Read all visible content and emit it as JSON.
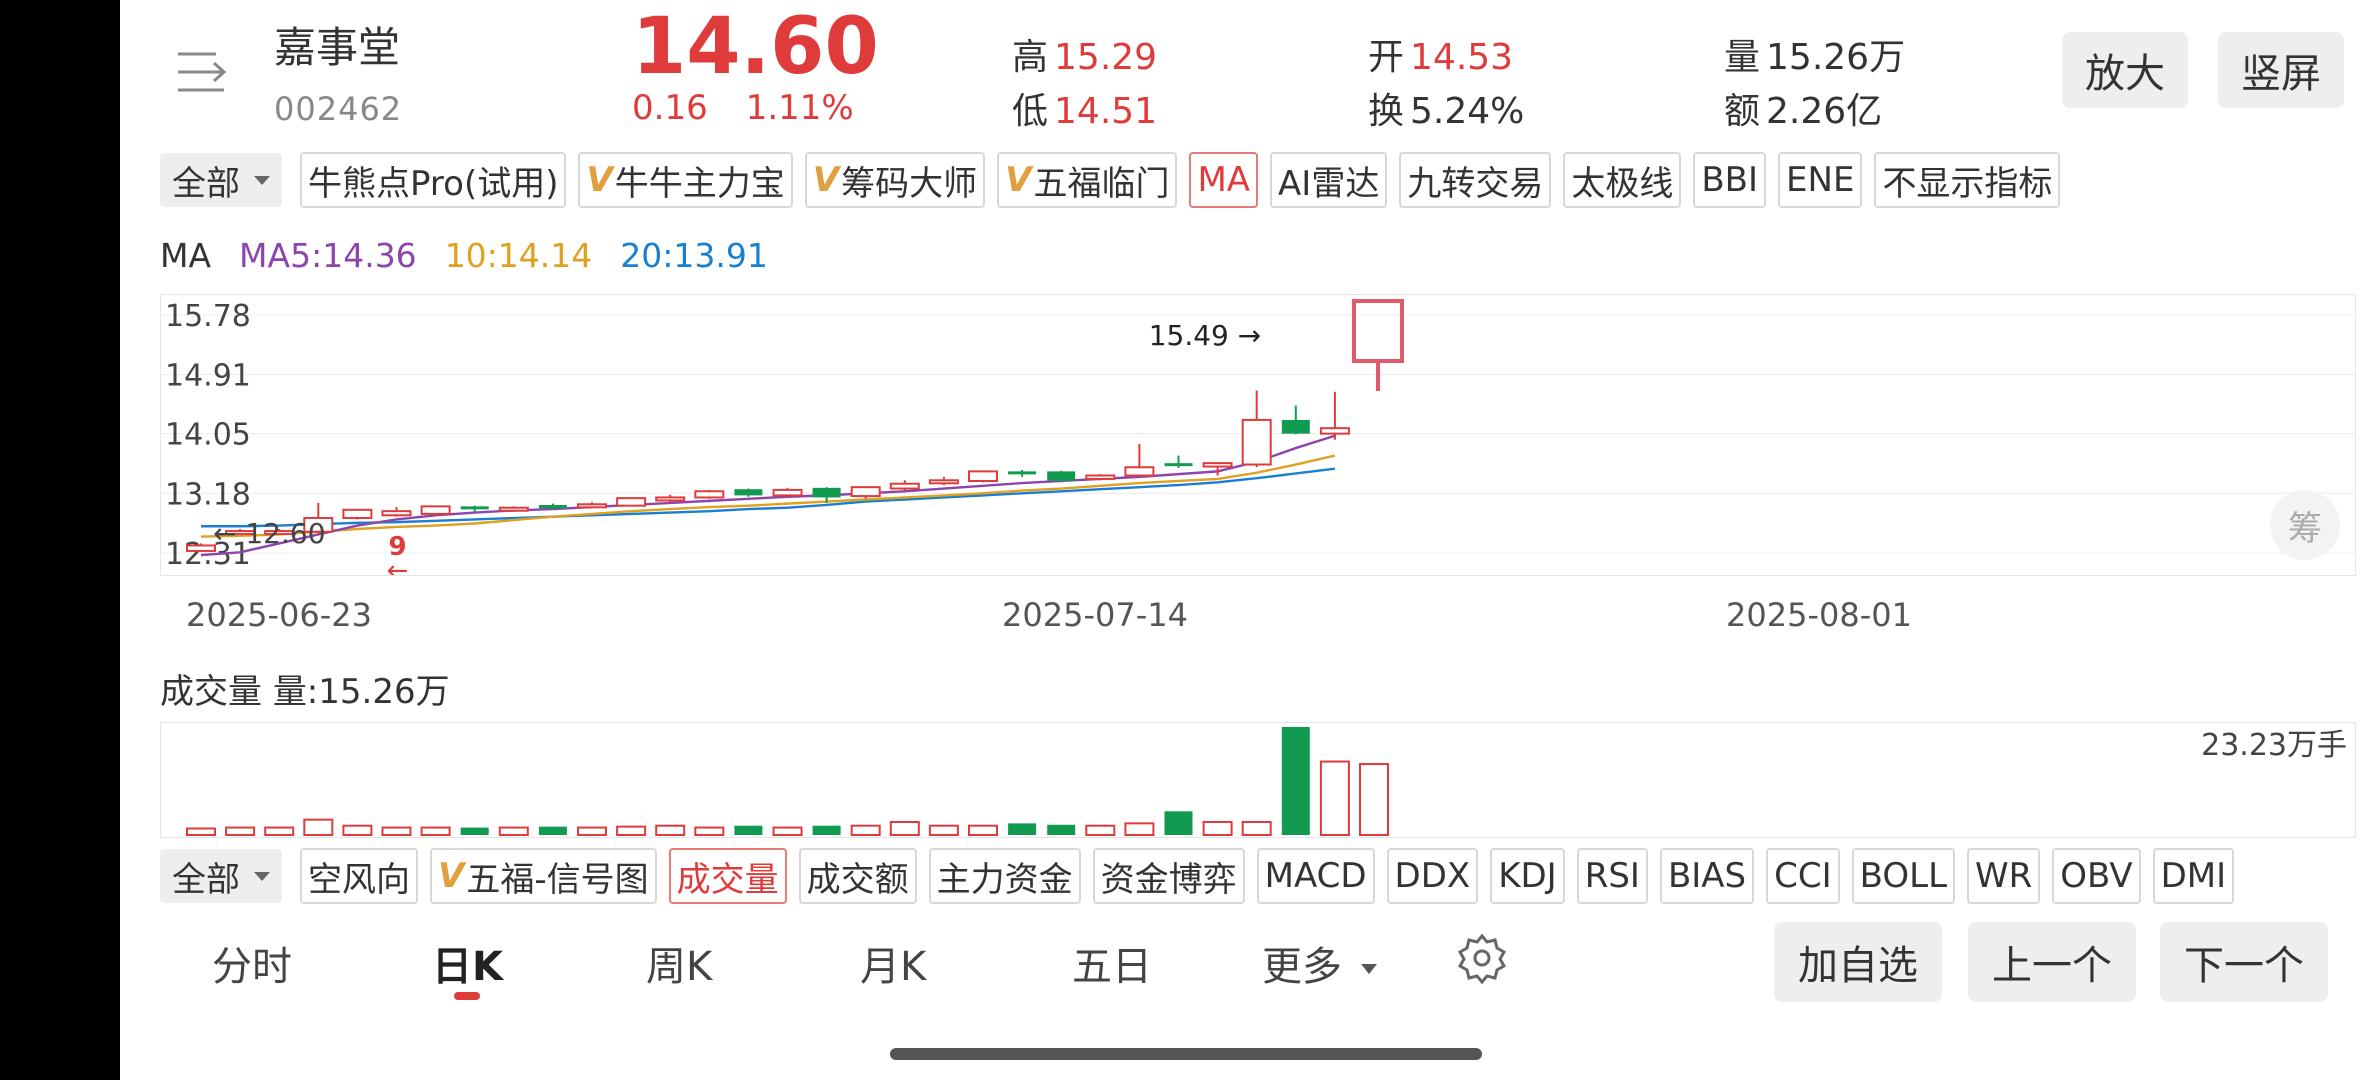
{
  "stock": {
    "name": "嘉事堂",
    "code": "002462",
    "price": "14.60",
    "change": "0.16",
    "change_pct": "1.11%"
  },
  "quote": {
    "high_label": "高",
    "high": "15.29",
    "low_label": "低",
    "low": "14.51",
    "open_label": "开",
    "open": "14.53",
    "turnover_label": "换",
    "turnover": "5.24%",
    "volume_label": "量",
    "volume": "15.26万",
    "amount_label": "额",
    "amount": "2.26亿"
  },
  "header_buttons": {
    "zoom": "放大",
    "portrait": "竖屏"
  },
  "main_indicators": {
    "dropdown": "全部",
    "tags": [
      {
        "label": "牛熊点Pro(试用)",
        "vip": false,
        "active": false
      },
      {
        "label": "牛牛主力宝",
        "vip": true,
        "active": false
      },
      {
        "label": "筹码大师",
        "vip": true,
        "active": false
      },
      {
        "label": "五福临门",
        "vip": true,
        "active": false
      },
      {
        "label": "MA",
        "vip": false,
        "active": true
      },
      {
        "label": "AI雷达",
        "vip": false,
        "active": false
      },
      {
        "label": "九转交易",
        "vip": false,
        "active": false
      },
      {
        "label": "太极线",
        "vip": false,
        "active": false
      },
      {
        "label": "BBI",
        "vip": false,
        "active": false
      },
      {
        "label": "ENE",
        "vip": false,
        "active": false
      },
      {
        "label": "不显示指标",
        "vip": false,
        "active": false
      }
    ]
  },
  "ma_legend": {
    "title": "MA",
    "ma5": "MA5:14.36",
    "ma10": "10:14.14",
    "ma20": "20:13.91",
    "colors": {
      "ma5": "#8e44ad",
      "ma10": "#e0a020",
      "ma20": "#1a7fd0"
    }
  },
  "chart_data": {
    "type": "candlestick",
    "y_ticks": [
      "15.78",
      "14.91",
      "14.05",
      "13.18",
      "12.31"
    ],
    "ylim": [
      12.31,
      15.78
    ],
    "x_labels": [
      "2025-06-23",
      "2025-07-14",
      "2025-08-01"
    ],
    "annotations": {
      "high_marker": "15.49",
      "low_marker": "12.60",
      "nine_count": "9"
    },
    "colors": {
      "up": "#e03b3b",
      "down": "#129b50"
    },
    "candles": [
      {
        "o": 12.34,
        "h": 12.45,
        "l": 12.33,
        "c": 12.42,
        "up": true
      },
      {
        "o": 12.6,
        "h": 12.66,
        "l": 12.58,
        "c": 12.63,
        "up": true
      },
      {
        "o": 12.6,
        "h": 12.66,
        "l": 12.58,
        "c": 12.63,
        "up": true
      },
      {
        "o": 12.62,
        "h": 13.04,
        "l": 12.58,
        "c": 12.82,
        "up": true
      },
      {
        "o": 12.82,
        "h": 12.94,
        "l": 12.8,
        "c": 12.94,
        "up": true
      },
      {
        "o": 12.86,
        "h": 12.98,
        "l": 12.84,
        "c": 12.92,
        "up": true
      },
      {
        "o": 12.88,
        "h": 12.99,
        "l": 12.86,
        "c": 12.99,
        "up": true
      },
      {
        "o": 12.99,
        "h": 13.0,
        "l": 12.91,
        "c": 12.95,
        "up": false
      },
      {
        "o": 12.93,
        "h": 12.99,
        "l": 12.91,
        "c": 12.97,
        "up": true
      },
      {
        "o": 13.01,
        "h": 13.03,
        "l": 12.94,
        "c": 12.96,
        "up": false
      },
      {
        "o": 12.98,
        "h": 13.05,
        "l": 12.96,
        "c": 13.02,
        "up": true
      },
      {
        "o": 13.0,
        "h": 13.11,
        "l": 12.99,
        "c": 13.11,
        "up": true
      },
      {
        "o": 13.09,
        "h": 13.16,
        "l": 13.05,
        "c": 13.12,
        "up": true
      },
      {
        "o": 13.12,
        "h": 13.23,
        "l": 13.1,
        "c": 13.21,
        "up": true
      },
      {
        "o": 13.24,
        "h": 13.25,
        "l": 13.13,
        "c": 13.15,
        "up": false
      },
      {
        "o": 13.15,
        "h": 13.26,
        "l": 13.13,
        "c": 13.23,
        "up": true
      },
      {
        "o": 13.26,
        "h": 13.27,
        "l": 13.04,
        "c": 13.12,
        "up": false
      },
      {
        "o": 13.14,
        "h": 13.28,
        "l": 13.1,
        "c": 13.27,
        "up": true
      },
      {
        "o": 13.25,
        "h": 13.37,
        "l": 13.21,
        "c": 13.32,
        "up": true
      },
      {
        "o": 13.33,
        "h": 13.42,
        "l": 13.3,
        "c": 13.37,
        "up": true
      },
      {
        "o": 13.36,
        "h": 13.5,
        "l": 13.34,
        "c": 13.5,
        "up": true
      },
      {
        "o": 13.5,
        "h": 13.52,
        "l": 13.42,
        "c": 13.47,
        "up": false
      },
      {
        "o": 13.5,
        "h": 13.51,
        "l": 13.34,
        "c": 13.36,
        "up": false
      },
      {
        "o": 13.39,
        "h": 13.46,
        "l": 13.37,
        "c": 13.44,
        "up": true
      },
      {
        "o": 13.44,
        "h": 13.9,
        "l": 13.42,
        "c": 13.56,
        "up": true
      },
      {
        "o": 13.62,
        "h": 13.73,
        "l": 13.55,
        "c": 13.58,
        "up": false
      },
      {
        "o": 13.57,
        "h": 13.63,
        "l": 13.44,
        "c": 13.62,
        "up": true
      },
      {
        "o": 13.6,
        "h": 14.68,
        "l": 13.56,
        "c": 14.25,
        "up": true
      },
      {
        "o": 14.25,
        "h": 14.46,
        "l": 14.04,
        "c": 14.05,
        "up": false
      },
      {
        "o": 14.05,
        "h": 14.66,
        "l": 13.96,
        "c": 14.13,
        "up": true
      }
    ],
    "ma5": [
      12.28,
      12.32,
      12.45,
      12.58,
      12.71,
      12.8,
      12.86,
      12.9,
      12.93,
      12.95,
      12.98,
      13.01,
      13.04,
      13.07,
      13.1,
      13.13,
      13.15,
      13.18,
      13.21,
      13.25,
      13.29,
      13.33,
      13.36,
      13.39,
      13.42,
      13.46,
      13.5,
      13.64,
      13.84,
      14.02
    ],
    "ma10": [
      12.55,
      12.56,
      12.58,
      12.62,
      12.66,
      12.69,
      12.71,
      12.74,
      12.79,
      12.84,
      12.88,
      12.92,
      12.95,
      12.98,
      13.0,
      13.03,
      13.06,
      13.09,
      13.12,
      13.15,
      13.18,
      13.22,
      13.25,
      13.29,
      13.33,
      13.36,
      13.39,
      13.48,
      13.6,
      13.73
    ],
    "ma20": [
      12.7,
      12.7,
      12.71,
      12.73,
      12.75,
      12.76,
      12.78,
      12.8,
      12.82,
      12.84,
      12.86,
      12.88,
      12.9,
      12.92,
      12.95,
      12.97,
      13.01,
      13.06,
      13.09,
      13.12,
      13.15,
      13.18,
      13.21,
      13.24,
      13.27,
      13.3,
      13.34,
      13.4,
      13.47,
      13.54
    ],
    "volume": {
      "title": "成交量",
      "current": "量:15.26万",
      "max_label": "23.23万手",
      "values": [
        1.4,
        1.6,
        1.6,
        3.3,
        2.0,
        1.6,
        1.6,
        1.6,
        1.6,
        1.8,
        1.6,
        1.8,
        2.0,
        1.6,
        2.0,
        1.6,
        2.0,
        2.0,
        2.8,
        2.0,
        2.0,
        2.5,
        2.2,
        2.0,
        2.5,
        5.1,
        2.8,
        2.8,
        23.23,
        15.8,
        15.26
      ]
    }
  },
  "sub_indicators": {
    "dropdown": "全部",
    "tags": [
      {
        "label": "空风向",
        "vip": false,
        "active": false
      },
      {
        "label": "五福-信号图",
        "vip": true,
        "active": false
      },
      {
        "label": "成交量",
        "vip": false,
        "active": true
      },
      {
        "label": "成交额",
        "vip": false,
        "active": false
      },
      {
        "label": "主力资金",
        "vip": false,
        "active": false
      },
      {
        "label": "资金博弈",
        "vip": false,
        "active": false
      },
      {
        "label": "MACD",
        "vip": false,
        "active": false
      },
      {
        "label": "DDX",
        "vip": false,
        "active": false
      },
      {
        "label": "KDJ",
        "vip": false,
        "active": false
      },
      {
        "label": "RSI",
        "vip": false,
        "active": false
      },
      {
        "label": "BIAS",
        "vip": false,
        "active": false
      },
      {
        "label": "CCI",
        "vip": false,
        "active": false
      },
      {
        "label": "BOLL",
        "vip": false,
        "active": false
      },
      {
        "label": "WR",
        "vip": false,
        "active": false
      },
      {
        "label": "OBV",
        "vip": false,
        "active": false
      },
      {
        "label": "DMI",
        "vip": false,
        "active": false
      }
    ]
  },
  "chou_button": "筹",
  "period_tabs": [
    {
      "label": "分时",
      "active": false
    },
    {
      "label": "日K",
      "active": true
    },
    {
      "label": "周K",
      "active": false
    },
    {
      "label": "月K",
      "active": false
    },
    {
      "label": "五日",
      "active": false
    },
    {
      "label": "更多",
      "active": false
    }
  ],
  "bottom_buttons": {
    "add_watch": "加自选",
    "prev": "上一个",
    "next": "下一个"
  }
}
